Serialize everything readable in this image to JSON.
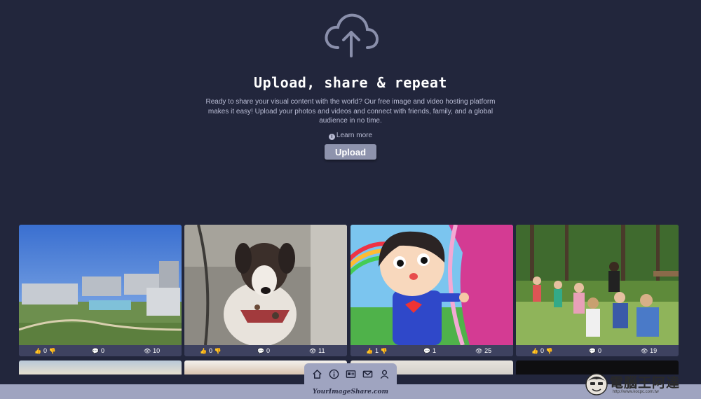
{
  "hero": {
    "title": "Upload, share & repeat",
    "description": "Ready to share your visual content with the world? Our free image and video hosting platform makes it easy! Upload your photos and videos and connect with friends, family, and a global audience in no time.",
    "learn_more": "Learn more",
    "upload_label": "Upload"
  },
  "cards": [
    {
      "likes": "0",
      "comments": "0",
      "views": "10"
    },
    {
      "likes": "0",
      "comments": "0",
      "views": "11"
    },
    {
      "likes": "1",
      "comments": "1",
      "views": "25"
    },
    {
      "likes": "0",
      "comments": "0",
      "views": "19"
    }
  ],
  "nav": {
    "items": [
      "home-icon",
      "info-icon",
      "id-card-icon",
      "mail-icon",
      "user-icon"
    ]
  },
  "footer": {
    "brand": "YourImageShare.com"
  },
  "watermark": {
    "text": "電腦王阿達",
    "url": "http://www.kocpc.com.tw"
  },
  "colors": {
    "background": "#22263c",
    "card_bar": "#3e4260",
    "button": "#8e93ad",
    "footer": "#9fa4c0"
  }
}
